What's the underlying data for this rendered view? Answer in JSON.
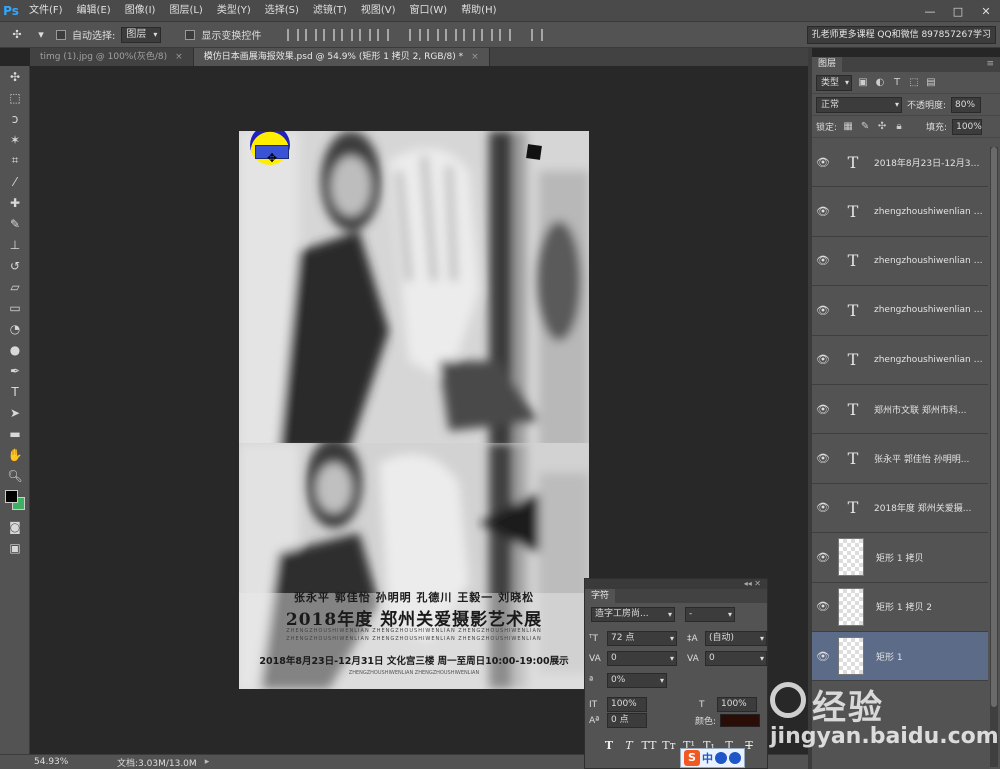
{
  "app": {
    "logo": "Ps",
    "menus": [
      "文件(F)",
      "编辑(E)",
      "图像(I)",
      "图层(L)",
      "类型(Y)",
      "选择(S)",
      "滤镜(T)",
      "视图(V)",
      "窗口(W)",
      "帮助(H)"
    ],
    "window_buttons": [
      "—",
      "□",
      "✕"
    ]
  },
  "options": {
    "auto_select_label": "自动选择:",
    "auto_select_value": "图层",
    "show_transform_label": "显示变换控件",
    "promo": "孔老师更多课程 QQ和微信 8978572​67学习"
  },
  "tabs": [
    {
      "label": "timg (1).jpg @ 100%(灰色/8)",
      "close": "×",
      "active": false
    },
    {
      "label": "模仿日本画展海报效果.psd @ 54.9% (矩形 1 拷贝 2, RGB/8) *",
      "close": "×",
      "active": true
    }
  ],
  "poster": {
    "names": "张永平  郭佳怡  孙明明  孔德川  王毅一  刘晓松",
    "headline": "2018年度 郑州关爱摄影艺术展",
    "small1": "ZHENGZHOUSHIWENLIAN  ZHENGZHOUSHIWENLIAN  ZHENGZHOUSHIWENLIAN",
    "small2": "ZHENGZHOUSHIWENLIAN  ZHENGZHOUSHIWENLIAN  ZHENGZHOUSHIWENLIAN",
    "dateline": "2018年8月23日-12月31日 文化宫三楼 周一至周日10:00-19:00展示",
    "small3": "ZHENGZHOUSHIWENLIAN ZHENGZHOUSHIWENLIAN"
  },
  "status": {
    "zoom": "54.93%",
    "doc": "文档:3.03M/13.0M",
    "arrow": "▸"
  },
  "layers_panel": {
    "title": "图层",
    "filter_kind": "类型",
    "blend_mode": "正常",
    "opacity_label": "不透明度:",
    "opacity_value": "80%",
    "lock_label": "锁定:",
    "fill_label": "填充:",
    "fill_value": "100%",
    "layers": [
      {
        "name": "2018年8月23日-12月31...",
        "type": "text",
        "selected": false
      },
      {
        "name": "zhengzhoushiwenlian  z...",
        "type": "text",
        "selected": false
      },
      {
        "name": "zhengzhoushiwenlian  z...",
        "type": "text",
        "selected": false
      },
      {
        "name": "zhengzhoushiwenlian  z...",
        "type": "text",
        "selected": false
      },
      {
        "name": "zhengzhoushiwenlian  z...",
        "type": "text",
        "selected": false
      },
      {
        "name": "郑州市文联  郑州市科...",
        "type": "text",
        "selected": false
      },
      {
        "name": "张永平  郭佳怡  孙明明...",
        "type": "text",
        "selected": false
      },
      {
        "name": "2018年度 郑州关爱摄...",
        "type": "text",
        "selected": false
      },
      {
        "name": "矩形 1 拷贝",
        "type": "shape",
        "selected": false
      },
      {
        "name": "矩形 1 拷贝 2",
        "type": "shape",
        "selected": false
      },
      {
        "name": "矩形 1",
        "type": "shape",
        "selected": true
      }
    ]
  },
  "char_panel": {
    "title": "字符",
    "collapse": "◂◂  ✕",
    "font": "造字工房尚...",
    "style": "-",
    "size": "72 点",
    "leading": "(自动)",
    "kerning": "0",
    "tracking": "0",
    "shift": "0%",
    "vscale": "100%",
    "hscale": "100%",
    "baseline": "0 点",
    "color_label": "颜色:",
    "color": "#2b0d08",
    "styles": [
      "T",
      "T",
      "TT",
      "Tт",
      "T¹",
      "T₁",
      "T",
      "T"
    ]
  },
  "watermark": {
    "ime_s": "S",
    "ime_zh": "中",
    "cn": "经验",
    "url": "jingyan.baidu.com"
  }
}
